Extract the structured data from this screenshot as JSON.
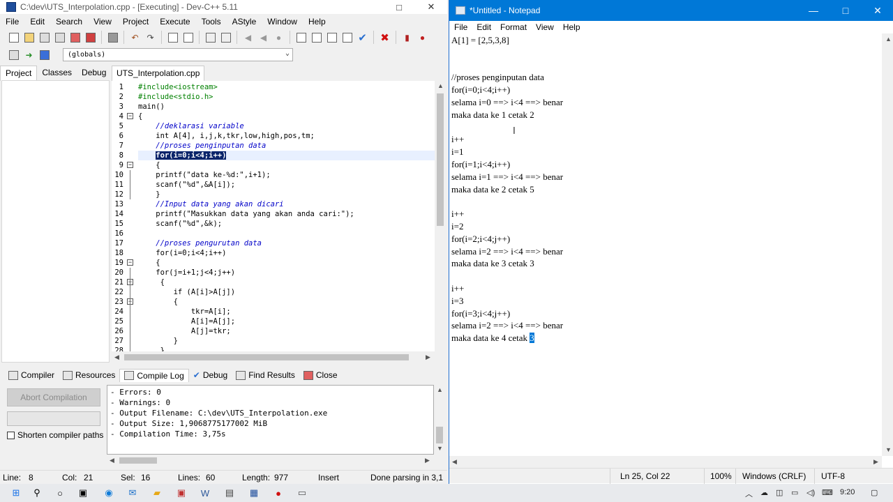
{
  "devcpp": {
    "title": "C:\\dev\\UTS_Interpolation.cpp - [Executing] - Dev-C++ 5.11",
    "menu": [
      "File",
      "Edit",
      "Search",
      "View",
      "Project",
      "Execute",
      "Tools",
      "AStyle",
      "Window",
      "Help"
    ],
    "globals_value": "(globals)",
    "left_tabs": [
      "Project",
      "Classes",
      "Debug"
    ],
    "editor_tab": "UTS_Interpolation.cpp",
    "code_lines": [
      {
        "n": "1",
        "text": "#include<iostream>"
      },
      {
        "n": "2",
        "text": "#include<stdio.h>"
      },
      {
        "n": "3",
        "text": "main()"
      },
      {
        "n": "4",
        "text": "{"
      },
      {
        "n": "5",
        "text": "    //deklarasi variable"
      },
      {
        "n": "6",
        "text": "    int A[4], i,j,k,tkr,low,high,pos,tm;"
      },
      {
        "n": "7",
        "text": "    //proses penginputan data"
      },
      {
        "n": "8",
        "text": "    for(i=0;i<4;i++)"
      },
      {
        "n": "9",
        "text": "    {"
      },
      {
        "n": "10",
        "text": "    printf(\"data ke-%d:\",i+1);"
      },
      {
        "n": "11",
        "text": "    scanf(\"%d\",&A[i]);"
      },
      {
        "n": "12",
        "text": "    }"
      },
      {
        "n": "13",
        "text": "    //Input data yang akan dicari"
      },
      {
        "n": "14",
        "text": "    printf(\"Masukkan data yang akan anda cari:\");"
      },
      {
        "n": "15",
        "text": "    scanf(\"%d\",&k);"
      },
      {
        "n": "16",
        "text": ""
      },
      {
        "n": "17",
        "text": "    //proses pengurutan data"
      },
      {
        "n": "18",
        "text": "    for(i=0;i<4;i++)"
      },
      {
        "n": "19",
        "text": "    {"
      },
      {
        "n": "20",
        "text": "    for(j=i+1;j<4;j++)"
      },
      {
        "n": "21",
        "text": "     {"
      },
      {
        "n": "22",
        "text": "        if (A[i]>A[j])"
      },
      {
        "n": "23",
        "text": "        {"
      },
      {
        "n": "24",
        "text": "            tkr=A[i];"
      },
      {
        "n": "25",
        "text": "            A[i]=A[j];"
      },
      {
        "n": "26",
        "text": "            A[j]=tkr;"
      },
      {
        "n": "27",
        "text": "        }"
      },
      {
        "n": "28",
        "text": "     }"
      }
    ],
    "bottom_tabs": [
      "Compiler",
      "Resources",
      "Compile Log",
      "Debug",
      "Find Results",
      "Close"
    ],
    "abort_label": "Abort Compilation",
    "shorten_label": "Shorten compiler paths",
    "log_lines": [
      "- Errors: 0",
      "- Warnings: 0",
      "- Output Filename: C:\\dev\\UTS_Interpolation.exe",
      "- Output Size: 1,9068775177002 MiB",
      "- Compilation Time: 3,75s"
    ],
    "status": {
      "line_label": "Line:",
      "line_val": "8",
      "col_label": "Col:",
      "col_val": "21",
      "sel_label": "Sel:",
      "sel_val": "16",
      "lines_label": "Lines:",
      "lines_val": "60",
      "length_label": "Length:",
      "length_val": "977",
      "mode": "Insert",
      "parse": "Done parsing in 3,1"
    }
  },
  "notepad": {
    "title": "*Untitled - Notepad",
    "menu": [
      "File",
      "Edit",
      "Format",
      "View",
      "Help"
    ],
    "lines": [
      "A[1] = [2,5,3,8]",
      "",
      "",
      "//proses penginputan data",
      "for(i=0;i<4;i++)",
      "selama i=0 ==> i<4 ==> benar",
      "maka data ke 1 cetak 2",
      "",
      "i++",
      "i=1",
      "for(i=1;i<4;i++)",
      "selama i=1 ==> i<4 ==> benar",
      "maka data ke 2 cetak 5",
      "",
      "i++",
      "i=2",
      "for(i=2;i<4;j++)",
      "selama i=2 ==> i<4 ==> benar",
      "maka data ke 3 cetak 3",
      "",
      "i++",
      "i=3",
      "for(i=3;i<4;j++)",
      "selama i=2 ==> i<4 ==> benar"
    ],
    "last_line_prefix": "maka data ke 4 cetak ",
    "last_line_selected": "3",
    "status": {
      "position": "Ln 25, Col 22",
      "zoom": "100%",
      "eol": "Windows (CRLF)",
      "encoding": "UTF-8"
    }
  },
  "taskbar": {
    "time": "9:20"
  },
  "colors": {
    "notepad_title": "#0078d7",
    "keyword": "#000000",
    "comment": "#0000c8",
    "string": "#0000ff",
    "selection": "#0a246a"
  }
}
